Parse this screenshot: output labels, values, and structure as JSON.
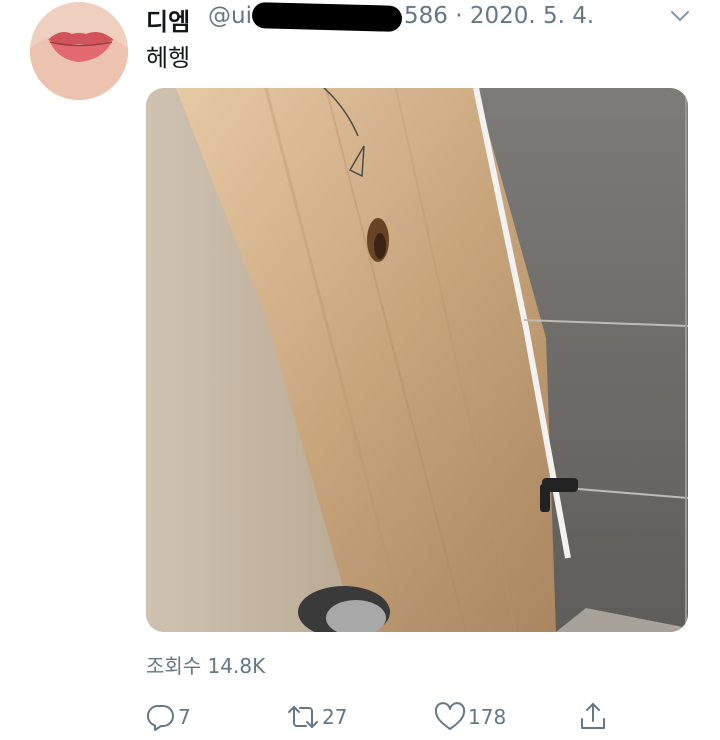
{
  "tweet": {
    "display_name": "디엠",
    "handle_prefix": "@ui",
    "handle_suffix": "586",
    "date_separator": "·",
    "date": "2020. 5. 4.",
    "text": "헤헹",
    "views_label": "조회수 14.8K"
  },
  "actions": {
    "reply_count": "7",
    "retweet_count": "27",
    "like_count": "178"
  },
  "icons": {
    "more": "chevron-down-icon",
    "reply": "reply-icon",
    "retweet": "retweet-icon",
    "like": "heart-icon",
    "share": "share-icon"
  },
  "colors": {
    "secondary_text": "#657786",
    "primary_text": "#14171a"
  }
}
